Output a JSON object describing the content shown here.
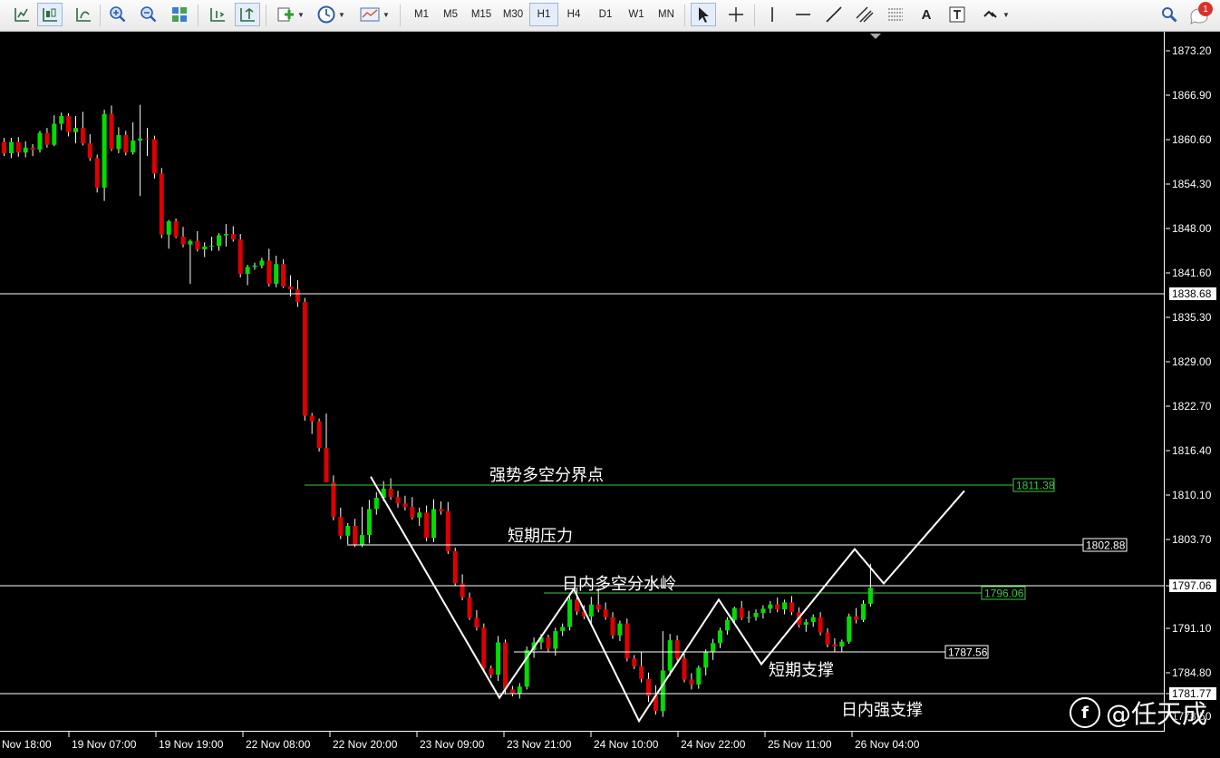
{
  "toolbar": {
    "timeframes": [
      "M1",
      "M5",
      "M15",
      "M30",
      "H1",
      "H4",
      "D1",
      "W1",
      "MN"
    ],
    "active_timeframe": "H1",
    "notification_count": "1",
    "text_tool_label": "A"
  },
  "price_axis": {
    "ticks": [
      "1873.20",
      "1866.90",
      "1860.60",
      "1854.30",
      "1848.00",
      "1841.60",
      "1835.30",
      "1829.00",
      "1822.70",
      "1816.40",
      "1810.10",
      "1803.70",
      "1797.06",
      "1791.10",
      "1784.80",
      "1781.77",
      "1778.50"
    ],
    "range": [
      1776.4,
      1876.0
    ]
  },
  "time_axis": {
    "ticks": [
      "Nov 18:00",
      "19 Nov 07:00",
      "19 Nov 19:00",
      "22 Nov 08:00",
      "22 Nov 20:00",
      "23 Nov 09:00",
      "23 Nov 21:00",
      "24 Nov 10:00",
      "24 Nov 22:00",
      "25 Nov 11:00",
      "26 Nov 04:00"
    ]
  },
  "levels": [
    {
      "name": "horizontal-line-1838",
      "value": "1838.68",
      "color": "#ffffff"
    },
    {
      "name": "horizontal-line-1797",
      "value": "1797.06",
      "color": "#ffffff"
    },
    {
      "name": "horizontal-line-1781",
      "value": "1781.77",
      "color": "#ffffff"
    },
    {
      "name": "level-strong-bull-bear",
      "value": "1811.38",
      "label": "强势多空分界点",
      "color": "#3cc83c"
    },
    {
      "name": "level-short-resistance",
      "value": "1802.88",
      "label": "短期压力",
      "color": "#ffffff"
    },
    {
      "name": "level-intraday-divide",
      "value": "1796.06",
      "label": "日内多空分水岭",
      "color": "#3cc83c"
    },
    {
      "name": "level-short-support",
      "value": "1787.56",
      "label": "短期支撑",
      "color": "#ffffff"
    },
    {
      "name": "level-intraday-strong-support",
      "value": "",
      "label": "日内强支撑",
      "color": "#ffffff"
    }
  ],
  "chart_data": {
    "type": "candlestick",
    "symbol_colors": {
      "bull": "#00dd00",
      "bear": "#dd0000",
      "background": "#000000"
    },
    "zigzag": [
      [
        1812.5
      ],
      [
        1781.0
      ],
      [
        1796.5
      ],
      [
        1777.7
      ],
      [
        1795.0
      ],
      [
        1785.8
      ],
      [
        1802.2
      ],
      [
        1797.3
      ],
      [
        1810.5
      ]
    ],
    "candles": [
      [
        1860.2,
        1860.8,
        1858.2,
        1858.6
      ],
      [
        1858.6,
        1860.8,
        1857.9,
        1860.2
      ],
      [
        1860.2,
        1860.9,
        1858.1,
        1858.7
      ],
      [
        1858.7,
        1860.3,
        1858.0,
        1859.4
      ],
      [
        1859.4,
        1859.9,
        1858.2,
        1859.1
      ],
      [
        1859.1,
        1861.8,
        1858.7,
        1861.5
      ],
      [
        1861.5,
        1862.2,
        1859.4,
        1859.8
      ],
      [
        1859.8,
        1864.0,
        1859.6,
        1862.8
      ],
      [
        1862.8,
        1864.4,
        1861.9,
        1863.9
      ],
      [
        1863.9,
        1864.3,
        1861.0,
        1861.6
      ],
      [
        1861.6,
        1863.9,
        1860.0,
        1862.2
      ],
      [
        1862.2,
        1864.5,
        1859.7,
        1860.0
      ],
      [
        1860.0,
        1861.3,
        1857.5,
        1857.9
      ],
      [
        1857.9,
        1858.4,
        1853.0,
        1853.7
      ],
      [
        1853.7,
        1864.8,
        1851.8,
        1864.2
      ],
      [
        1864.2,
        1865.4,
        1858.9,
        1859.2
      ],
      [
        1859.2,
        1862.3,
        1858.6,
        1861.2
      ],
      [
        1861.2,
        1861.8,
        1858.3,
        1858.7
      ],
      [
        1858.7,
        1863.0,
        1858.4,
        1860.4
      ],
      [
        1860.4,
        1865.5,
        1852.5,
        1860.7
      ],
      [
        1860.7,
        1862.2,
        1858.2,
        1860.6
      ],
      [
        1860.6,
        1861.1,
        1855.0,
        1855.7
      ],
      [
        1855.7,
        1856.5,
        1846.5,
        1847.0
      ],
      [
        1847.0,
        1849.1,
        1845.0,
        1848.9
      ],
      [
        1848.9,
        1849.3,
        1846.5,
        1846.7
      ],
      [
        1846.7,
        1848.1,
        1845.2,
        1845.6
      ],
      [
        1845.6,
        1846.3,
        1840.0,
        1846.1
      ],
      [
        1846.1,
        1847.5,
        1844.6,
        1844.9
      ],
      [
        1844.9,
        1845.9,
        1843.8,
        1845.3
      ],
      [
        1845.3,
        1846.7,
        1844.7,
        1845.4
      ],
      [
        1845.4,
        1847.2,
        1844.7,
        1846.9
      ],
      [
        1846.9,
        1848.5,
        1845.3,
        1847.1
      ],
      [
        1847.1,
        1848.2,
        1846.0,
        1846.3
      ],
      [
        1846.3,
        1847.1,
        1840.9,
        1841.4
      ],
      [
        1841.4,
        1842.7,
        1839.8,
        1842.4
      ],
      [
        1842.4,
        1843.0,
        1842.0,
        1842.6
      ],
      [
        1842.6,
        1843.7,
        1842.2,
        1843.3
      ],
      [
        1843.3,
        1845.0,
        1839.6,
        1840.0
      ],
      [
        1840.0,
        1844.0,
        1839.5,
        1842.8
      ],
      [
        1842.8,
        1843.5,
        1839.4,
        1839.6
      ],
      [
        1839.6,
        1841.2,
        1838.2,
        1839.2
      ],
      [
        1839.2,
        1840.5,
        1836.7,
        1837.4
      ],
      [
        1837.4,
        1838.0,
        1820.5,
        1821.2
      ],
      [
        1821.2,
        1821.6,
        1818.6,
        1820.4
      ],
      [
        1820.4,
        1820.8,
        1816.1,
        1816.6
      ],
      [
        1816.6,
        1821.5,
        1811.8,
        1811.7
      ],
      [
        1811.7,
        1812.7,
        1806.3,
        1806.8
      ],
      [
        1806.8,
        1808.1,
        1803.6,
        1804.1
      ],
      [
        1804.1,
        1805.9,
        1802.9,
        1805.5
      ],
      [
        1805.5,
        1806.5,
        1802.5,
        1802.8
      ],
      [
        1802.8,
        1808.2,
        1802.5,
        1804.2
      ],
      [
        1804.2,
        1809.2,
        1803.0,
        1807.9
      ],
      [
        1807.9,
        1810.3,
        1807.1,
        1809.5
      ],
      [
        1809.5,
        1811.9,
        1809.0,
        1810.8
      ],
      [
        1810.8,
        1812.3,
        1809.2,
        1809.6
      ],
      [
        1809.6,
        1810.5,
        1808.1,
        1808.7
      ],
      [
        1808.7,
        1809.8,
        1807.7,
        1808.2
      ],
      [
        1808.2,
        1809.6,
        1806.4,
        1806.7
      ],
      [
        1806.7,
        1808.1,
        1805.5,
        1807.4
      ],
      [
        1807.4,
        1808.4,
        1803.3,
        1803.8
      ],
      [
        1803.8,
        1809.3,
        1803.2,
        1807.9
      ],
      [
        1807.9,
        1809.0,
        1807.1,
        1807.6
      ],
      [
        1807.6,
        1808.9,
        1801.5,
        1801.9
      ],
      [
        1801.9,
        1802.4,
        1796.9,
        1797.3
      ],
      [
        1797.3,
        1798.6,
        1794.9,
        1795.3
      ],
      [
        1795.3,
        1796.0,
        1792.1,
        1792.4
      ],
      [
        1792.4,
        1793.5,
        1790.6,
        1791.0
      ],
      [
        1791.0,
        1791.6,
        1784.8,
        1785.2
      ],
      [
        1785.2,
        1785.6,
        1783.8,
        1784.3
      ],
      [
        1784.3,
        1789.8,
        1783.4,
        1788.9
      ],
      [
        1788.9,
        1789.3,
        1781.5,
        1782.2
      ],
      [
        1782.2,
        1782.7,
        1781.2,
        1781.6
      ],
      [
        1781.6,
        1783.1,
        1780.9,
        1782.6
      ],
      [
        1782.6,
        1788.3,
        1782.2,
        1787.8
      ],
      [
        1787.8,
        1789.6,
        1786.7,
        1788.9
      ],
      [
        1788.9,
        1790.1,
        1787.9,
        1789.6
      ],
      [
        1789.6,
        1790.0,
        1787.5,
        1788.0
      ],
      [
        1788.0,
        1791.0,
        1787.0,
        1790.5
      ],
      [
        1790.5,
        1791.6,
        1789.8,
        1791.1
      ],
      [
        1791.1,
        1795.4,
        1790.6,
        1795.0
      ],
      [
        1795.0,
        1796.7,
        1792.8,
        1793.3
      ],
      [
        1793.3,
        1794.2,
        1792.2,
        1792.6
      ],
      [
        1792.6,
        1795.4,
        1791.5,
        1794.3
      ],
      [
        1794.3,
        1796.6,
        1793.2,
        1793.6
      ],
      [
        1793.6,
        1794.6,
        1792.1,
        1792.5
      ],
      [
        1792.5,
        1793.2,
        1789.4,
        1789.9
      ],
      [
        1789.9,
        1792.0,
        1789.1,
        1791.6
      ],
      [
        1791.6,
        1792.3,
        1786.2,
        1786.6
      ],
      [
        1786.6,
        1787.1,
        1785.1,
        1785.5
      ],
      [
        1785.5,
        1787.5,
        1783.2,
        1783.7
      ],
      [
        1783.7,
        1784.6,
        1780.4,
        1781.3
      ],
      [
        1781.3,
        1782.8,
        1778.6,
        1779.1
      ],
      [
        1779.1,
        1790.5,
        1778.3,
        1784.9
      ],
      [
        1784.9,
        1790.1,
        1784.1,
        1789.2
      ],
      [
        1789.2,
        1789.9,
        1786.3,
        1786.6
      ],
      [
        1786.6,
        1787.3,
        1783.2,
        1783.6
      ],
      [
        1783.6,
        1784.5,
        1782.2,
        1782.9
      ],
      [
        1782.9,
        1785.6,
        1782.3,
        1785.3
      ],
      [
        1785.3,
        1787.9,
        1784.2,
        1787.5
      ],
      [
        1787.5,
        1789.4,
        1786.4,
        1788.8
      ],
      [
        1788.8,
        1791.0,
        1788.1,
        1790.6
      ],
      [
        1790.6,
        1792.5,
        1790.0,
        1792.1
      ],
      [
        1792.1,
        1794.0,
        1791.5,
        1793.8
      ],
      [
        1793.8,
        1794.8,
        1792.1,
        1792.4
      ],
      [
        1792.4,
        1793.4,
        1791.7,
        1792.5
      ],
      [
        1792.5,
        1793.6,
        1792.0,
        1793.1
      ],
      [
        1793.1,
        1794.2,
        1792.3,
        1793.7
      ],
      [
        1793.7,
        1794.8,
        1793.1,
        1794.3
      ],
      [
        1794.3,
        1795.3,
        1793.2,
        1793.6
      ],
      [
        1793.6,
        1795.0,
        1792.9,
        1794.6
      ],
      [
        1794.6,
        1795.5,
        1792.8,
        1793.2
      ],
      [
        1793.2,
        1793.9,
        1791.0,
        1791.4
      ],
      [
        1791.4,
        1792.2,
        1790.4,
        1791.8
      ],
      [
        1791.8,
        1792.9,
        1791.1,
        1792.5
      ],
      [
        1792.5,
        1793.2,
        1789.9,
        1790.3
      ],
      [
        1790.3,
        1790.9,
        1788.2,
        1788.6
      ],
      [
        1788.6,
        1789.5,
        1787.6,
        1788.3
      ],
      [
        1788.3,
        1789.3,
        1787.6,
        1789.0
      ],
      [
        1789.0,
        1793.0,
        1788.7,
        1792.6
      ],
      [
        1792.6,
        1793.8,
        1791.6,
        1792.1
      ],
      [
        1792.1,
        1794.9,
        1791.8,
        1794.4
      ],
      [
        1794.4,
        1800.1,
        1794.0,
        1796.7
      ]
    ]
  }
}
